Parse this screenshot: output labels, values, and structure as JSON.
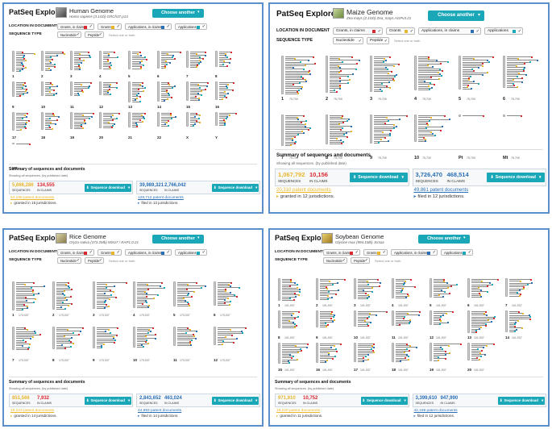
{
  "app_name": "PatSeq Explorer",
  "choose_label": "Choose another genome",
  "location_label": "LOCATION IN DOCUMENT",
  "seqtype_label": "SEQUENCE TYPE",
  "loc_options": [
    "Grants, in claims",
    "Grants",
    "Applications, in claims",
    "Applications"
  ],
  "seq_options": [
    "Nucleotide",
    "Peptide"
  ],
  "select_hint": "Select one or both",
  "summary_title": "Summary of sequences and documents",
  "showing_text": "Showing all sequences. (by published date)",
  "download_label": "Sequence download",
  "sequences_cap": "SEQUENCES",
  "inclaims_cap": "IN CLAIMS",
  "colors": {
    "grants_claims": "#d9282f",
    "grants": "#e8b52b",
    "apps_claims": "#2a6fb5",
    "apps": "#1aa7b7",
    "panel_border": "#5b8fc9"
  },
  "panels": [
    {
      "id": "human",
      "genome": "Human Genome",
      "subtitle": "Homo sapiens (3.1Gb)   GRCh37.p13",
      "chromosomes": [
        "1",
        "2",
        "3",
        "4",
        "5",
        "6",
        "7",
        "8",
        "9",
        "10",
        "11",
        "12",
        "13",
        "14",
        "15",
        "16",
        "17",
        "18",
        "19",
        "20",
        "21",
        "22",
        "X",
        "Y",
        "MT"
      ],
      "left_grants": "5,666,286",
      "left_claims": "134,555",
      "right_grants": "39,989,321",
      "right_claims": "2,766,042",
      "left_docs": "54,188 patent documents",
      "left_juris": "granted in 15 jurisdictions.",
      "right_docs": "128,712 patent documents",
      "right_juris": "filed in 13 jurisdictions."
    },
    {
      "id": "maize",
      "genome": "Maize Genome",
      "subtitle": "Zea mays (2.1Gb)   Zea_mays.AGPv3.21",
      "chromosomes": [
        "1",
        "2",
        "3",
        "4",
        "5",
        "6",
        "7",
        "8",
        "9",
        "10",
        "Pt",
        "Mt"
      ],
      "lengths": [
        "75,709",
        "75,709",
        "75,709",
        "75,709",
        "75,709",
        "75,709",
        "75,709",
        "75,709",
        "75,709",
        "75,709",
        "75,709",
        "75,709"
      ],
      "left_grants": "1,067,792",
      "left_claims": "10,156",
      "right_grants": "3,726,470",
      "right_claims": "468,514",
      "left_docs": "20,310 patent documents",
      "left_juris": "granted in 12 jurisdictions.",
      "right_docs": "49,861 patent documents",
      "right_juris": "filed in 12 jurisdictions."
    },
    {
      "id": "rice",
      "genome": "Rice Genome",
      "subtitle": "Oryza sativa (373.2Mb)   MSU7 / RAP1.0.21",
      "chromosomes": [
        "1",
        "2",
        "3",
        "4",
        "5",
        "6",
        "7",
        "8",
        "9",
        "10",
        "11",
        "12"
      ],
      "lengths": [
        "173,037",
        "173,037",
        "173,037",
        "173,037",
        "173,037",
        "173,037",
        "173,037",
        "173,037",
        "173,037",
        "173,037",
        "173,037",
        "173,037"
      ],
      "left_grants": "851,566",
      "left_claims": "7,932",
      "right_grants": "2,843,652",
      "right_claims": "463,024",
      "left_docs": "19,223 patent documents",
      "left_juris": "granted in 14 jurisdictions.",
      "right_docs": "44,993 patent documents",
      "right_juris": "filed in 14 jurisdictions."
    },
    {
      "id": "soybean",
      "genome": "Soybean Genome",
      "subtitle": "Glycine max (994.1Mb)   Jcmax",
      "chromosomes": [
        "1",
        "2",
        "3",
        "4",
        "5",
        "6",
        "7",
        "8",
        "9",
        "10",
        "11",
        "12",
        "13",
        "14",
        "15",
        "16",
        "17",
        "18",
        "19",
        "20"
      ],
      "lengths": [
        "101,937",
        "101,937",
        "101,937",
        "101,937",
        "101,937",
        "101,937",
        "101,937",
        "101,937",
        "101,937",
        "101,937",
        "101,937",
        "101,937",
        "101,937",
        "101,937",
        "101,937",
        "101,937",
        "101,937",
        "101,937",
        "101,937",
        "101,937"
      ],
      "left_grants": "971,910",
      "left_claims": "10,752",
      "right_grants": "3,399,610",
      "right_claims": "947,990",
      "left_docs": "19,220 patent documents",
      "left_juris": "granted in 11 jurisdictions.",
      "right_docs": "42,159 patent documents",
      "right_juris": "filed in 12 jurisdictions."
    }
  ]
}
